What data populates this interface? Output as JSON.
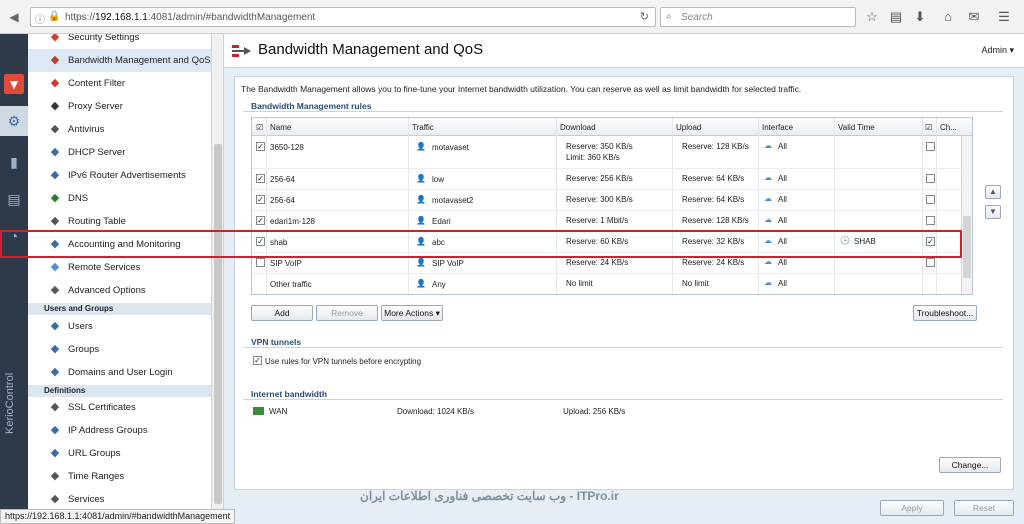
{
  "browser": {
    "url_prefix": "https://",
    "url_host": "192.168.1.1",
    "url_rest": ":4081/admin/#bandwidthManagement",
    "search_placeholder": "Search",
    "status_url": "https://192.168.1.1:4081/admin/#bandwidthManagement"
  },
  "brand": "KerioControl",
  "sidebar": {
    "items": [
      {
        "label": "Security Settings",
        "icon": "shield-icon",
        "color": "#d43c2b"
      },
      {
        "label": "Bandwidth Management and QoS",
        "icon": "bandwidth-icon",
        "color": "#c0392b",
        "selected": true
      },
      {
        "label": "Content Filter",
        "icon": "funnel-icon",
        "color": "#d9342b"
      },
      {
        "label": "Proxy Server",
        "icon": "proxy-icon",
        "color": "#333"
      },
      {
        "label": "Antivirus",
        "icon": "syringe-icon",
        "color": "#555"
      },
      {
        "label": "DHCP Server",
        "icon": "monitor-icon",
        "color": "#3b6aa6"
      },
      {
        "label": "IPv6 Router Advertisements",
        "icon": "ipv6-icon",
        "color": "#3b6aa6"
      },
      {
        "label": "DNS",
        "icon": "dns-icon",
        "color": "#2a7a3a"
      },
      {
        "label": "Routing Table",
        "icon": "routing-icon",
        "color": "#555"
      },
      {
        "label": "Accounting and Monitoring",
        "icon": "chart-icon",
        "color": "#3b6aa6"
      },
      {
        "label": "Remote Services",
        "icon": "cloud-icon",
        "color": "#4a8fcf"
      },
      {
        "label": "Advanced Options",
        "icon": "wrench-icon",
        "color": "#555"
      }
    ],
    "section_users": "Users and Groups",
    "users_items": [
      {
        "label": "Users",
        "icon": "user-icon",
        "color": "#3b6aa6"
      },
      {
        "label": "Groups",
        "icon": "group-icon",
        "color": "#3b6aa6"
      },
      {
        "label": "Domains and User Login",
        "icon": "domain-icon",
        "color": "#3b6aa6"
      }
    ],
    "section_definitions": "Definitions",
    "def_items": [
      {
        "label": "SSL Certificates",
        "icon": "certificate-icon",
        "color": "#555"
      },
      {
        "label": "IP Address Groups",
        "icon": "ip-group-icon",
        "color": "#3b6aa6"
      },
      {
        "label": "URL Groups",
        "icon": "globe-icon",
        "color": "#3b6aa6"
      },
      {
        "label": "Time Ranges",
        "icon": "clock-icon",
        "color": "#555"
      },
      {
        "label": "Services",
        "icon": "services-icon",
        "color": "#555"
      }
    ]
  },
  "page": {
    "title": "Bandwidth Management and QoS",
    "admin_menu": "Admin ▾",
    "intro": "The Bandwidth Management allows you to fine-tune your Internet bandwidth utilization. You can reserve as well as limit bandwidth for selected traffic.",
    "rules_title": "Bandwidth Management rules",
    "columns": [
      "Name",
      "Traffic",
      "Download",
      "Upload",
      "Interface",
      "Valid Time",
      "Ch..."
    ],
    "rows": [
      {
        "checked": true,
        "name": "3650-128",
        "traffic": "motavaset",
        "download": "Reserve: 350 KB/s",
        "download2": "Limit: 360 KB/s",
        "upload": "Reserve: 128 KB/s",
        "iface": "All",
        "valid": "",
        "ch": false
      },
      {
        "checked": true,
        "name": "256-64",
        "traffic": "low",
        "download": "Reserve: 256 KB/s",
        "download2": "",
        "upload": "Reserve: 64 KB/s",
        "iface": "All",
        "valid": "",
        "ch": false
      },
      {
        "checked": true,
        "name": "256-64",
        "traffic": "motavaset2",
        "download": "Reserve: 300 KB/s",
        "download2": "",
        "upload": "Reserve: 64 KB/s",
        "iface": "All",
        "valid": "",
        "ch": false
      },
      {
        "checked": true,
        "name": "edari1m-128",
        "traffic": "Edari",
        "download": "Reserve: 1 Mbit/s",
        "download2": "",
        "upload": "Reserve: 128 KB/s",
        "iface": "All",
        "valid": "",
        "ch": false
      },
      {
        "checked": true,
        "name": "shab",
        "traffic": "abc",
        "download": "Reserve: 60 KB/s",
        "download2": "",
        "upload": "Reserve: 32 KB/s",
        "iface": "All",
        "valid": "SHAB",
        "ch": true
      },
      {
        "checked": false,
        "name": "SIP VoIP",
        "traffic": "SIP VoIP",
        "download": "Reserve: 24 KB/s",
        "download2": "",
        "upload": "Reserve: 24 KB/s",
        "iface": "All",
        "valid": "",
        "ch": false
      },
      {
        "checked": null,
        "name": "Other traffic",
        "traffic": "Any",
        "download": "No limit",
        "download2": "",
        "upload": "No limit",
        "iface": "All",
        "valid": "",
        "ch": null
      }
    ],
    "buttons": {
      "add": "Add",
      "remove": "Remove",
      "more_actions": "More Actions ▾",
      "troubleshoot": "Troubleshoot..."
    },
    "vpn_title": "VPN tunnels",
    "vpn_checkbox": "Use rules for VPN tunnels before encrypting",
    "inet_title": "Internet bandwidth",
    "inet_name": "WAN",
    "inet_download": "Download: 1024 KB/s",
    "inet_upload": "Upload: 256 KB/s",
    "change_btn": "Change...",
    "apply_btn": "Apply",
    "reset_btn": "Reset"
  },
  "watermark": "وب سایت تخصصی فناوری اطلاعات ایران - ITPro.ir",
  "accent": "#d0202a"
}
